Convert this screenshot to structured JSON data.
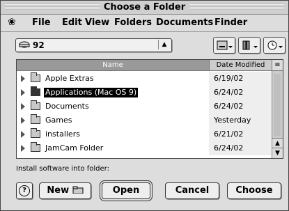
{
  "window": {
    "title": "Choose a Folder"
  },
  "menubar": {
    "apple_icon": "apple-logo-icon",
    "items": [
      "File",
      "Edit",
      "View",
      "Folders",
      "Documents",
      "Finder"
    ]
  },
  "location": {
    "volume": "92",
    "icon": "disk-icon"
  },
  "toolbar": {
    "drive_icon": "drive-icon",
    "favorites_icon": "favorites-icon",
    "recent_icon": "clock-icon"
  },
  "list": {
    "columns": [
      "Name",
      "Date Modified"
    ],
    "rows": [
      {
        "name": "Apple Extras",
        "date": "6/19/02"
      },
      {
        "name": "Applications (Mac OS 9)",
        "date": "6/24/02"
      },
      {
        "name": "Documents",
        "date": "6/24/02"
      },
      {
        "name": "Games",
        "date": "Yesterday"
      },
      {
        "name": "installers",
        "date": "6/21/02"
      },
      {
        "name": "JamCam Folder",
        "date": "6/24/02"
      }
    ]
  },
  "status": "Install software into folder:",
  "buttons": {
    "help": "?",
    "new": "New",
    "open": "Open",
    "cancel": "Cancel",
    "choose": "Choose"
  }
}
